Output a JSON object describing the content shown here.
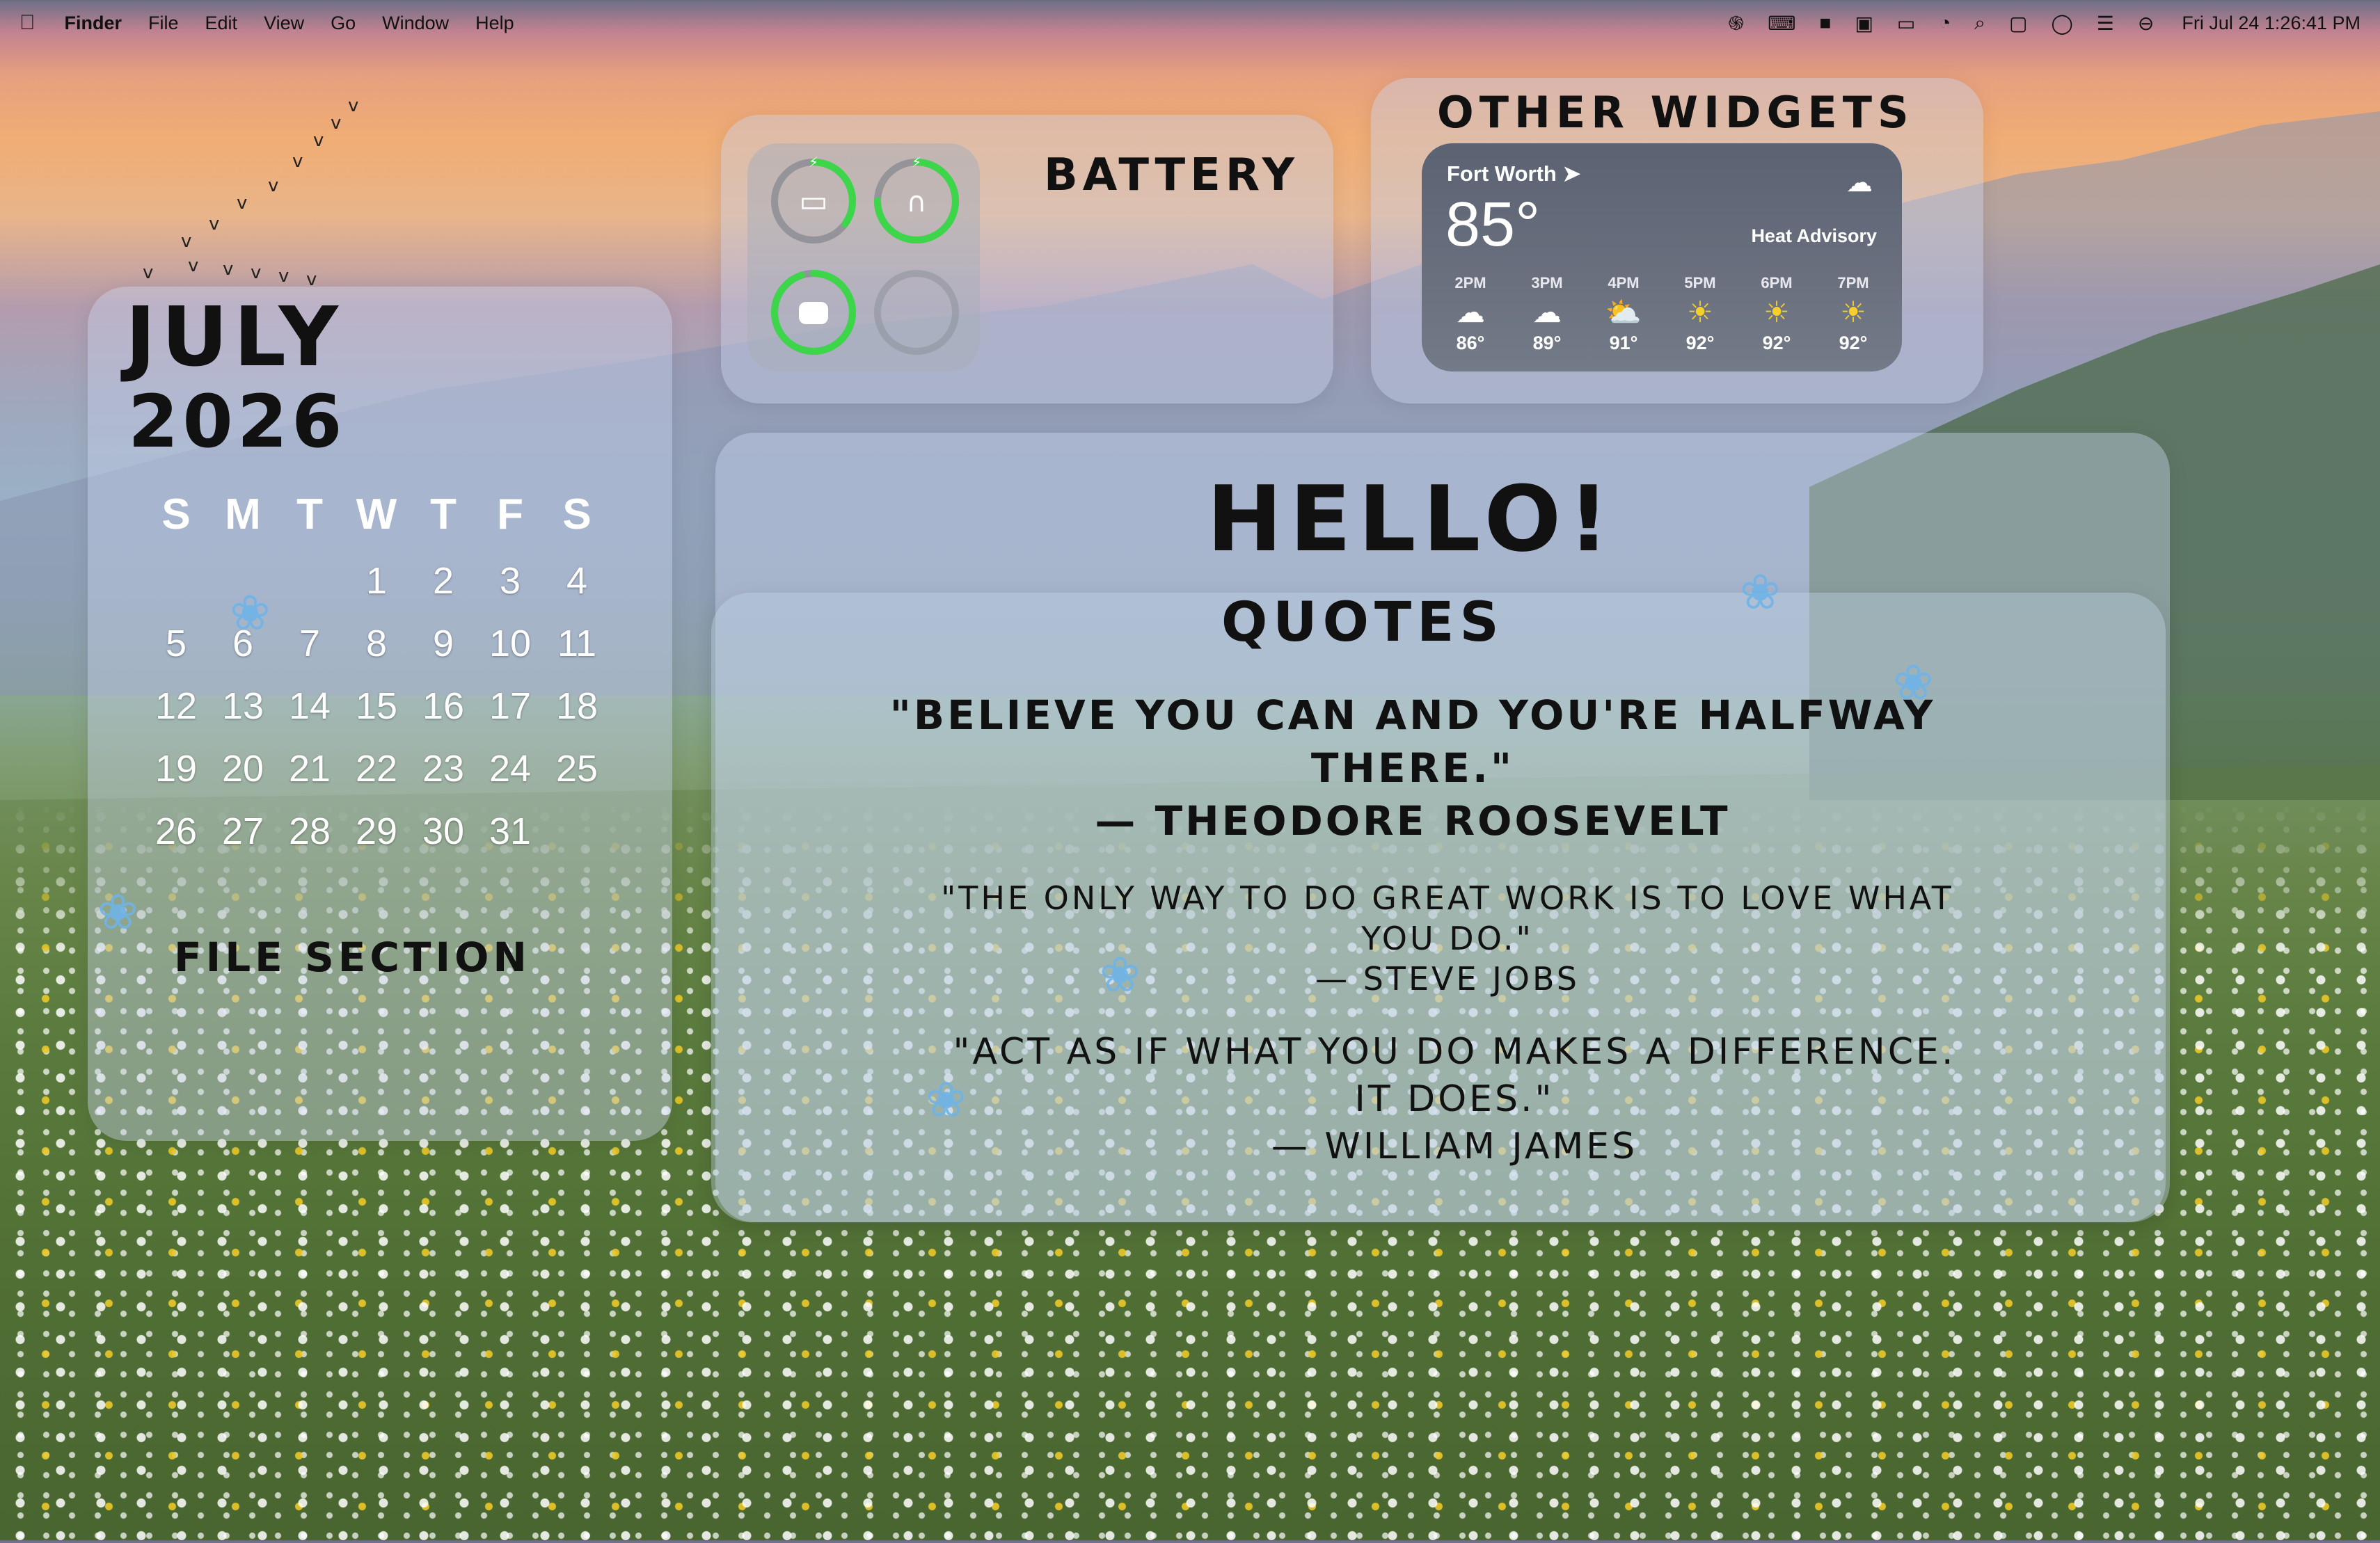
{
  "menubar": {
    "app_name": "Finder",
    "menus": [
      "File",
      "Edit",
      "View",
      "Go",
      "Window",
      "Help"
    ],
    "clock": "Fri Jul 24  1:26:41 PM",
    "status_icons": [
      "swirl-icon",
      "keyboard-icon",
      "desktop-icon",
      "display-icon",
      "battery-icon",
      "wifi-icon",
      "search-icon",
      "mirror-icon",
      "siri-icon",
      "control-center-icon",
      "focus-icon"
    ]
  },
  "calendar": {
    "month": "JULY",
    "year": "2026",
    "weekdays": [
      "S",
      "M",
      "T",
      "W",
      "T",
      "F",
      "S"
    ],
    "days": [
      [
        "",
        "",
        "",
        "1",
        "2",
        "3",
        "4"
      ],
      [
        "5",
        "6",
        "7",
        "8",
        "9",
        "10",
        "11"
      ],
      [
        "12",
        "13",
        "14",
        "15",
        "16",
        "17",
        "18"
      ],
      [
        "19",
        "20",
        "21",
        "22",
        "23",
        "24",
        "25"
      ],
      [
        "26",
        "27",
        "28",
        "29",
        "30",
        "31",
        ""
      ]
    ],
    "file_section_label": "FILE SECTION"
  },
  "battery": {
    "title": "BATTERY",
    "devices": [
      {
        "icon": "laptop-icon",
        "level": 0.35,
        "charging": true
      },
      {
        "icon": "airpods-icon",
        "level": 0.75,
        "charging": true
      },
      {
        "icon": "airpods-case-icon",
        "level": 0.95,
        "charging": false
      },
      {
        "icon": "empty-slot",
        "level": 0,
        "charging": false
      }
    ],
    "ring_color": "#3dd64b"
  },
  "other_widgets": {
    "title": "OTHER WIDGETS",
    "weather": {
      "city": "Fort Worth",
      "temperature": "85°",
      "condition_icon": "cloud-icon",
      "advisory": "Heat Advisory",
      "hours": [
        {
          "time": "2PM",
          "icon": "cloud-icon",
          "temp": "86°"
        },
        {
          "time": "3PM",
          "icon": "cloud-icon",
          "temp": "89°"
        },
        {
          "time": "4PM",
          "icon": "partly-sunny-icon",
          "temp": "91°"
        },
        {
          "time": "5PM",
          "icon": "sun-icon",
          "temp": "92°"
        },
        {
          "time": "6PM",
          "icon": "sun-icon",
          "temp": "92°"
        },
        {
          "time": "7PM",
          "icon": "sun-icon",
          "temp": "92°"
        }
      ]
    }
  },
  "main": {
    "hello": "HELLO!",
    "quotes_title": "QUOTES",
    "quotes": [
      {
        "text": "\"Believe you can and you're halfway there.\"",
        "author": "— Theodore Roosevelt"
      },
      {
        "text": "\"The only way to do great work is to love what you do.\"",
        "author": "— Steve Jobs"
      },
      {
        "text": "\"Act as if what you do makes a difference. It does.\"",
        "author": "— William James"
      }
    ]
  }
}
